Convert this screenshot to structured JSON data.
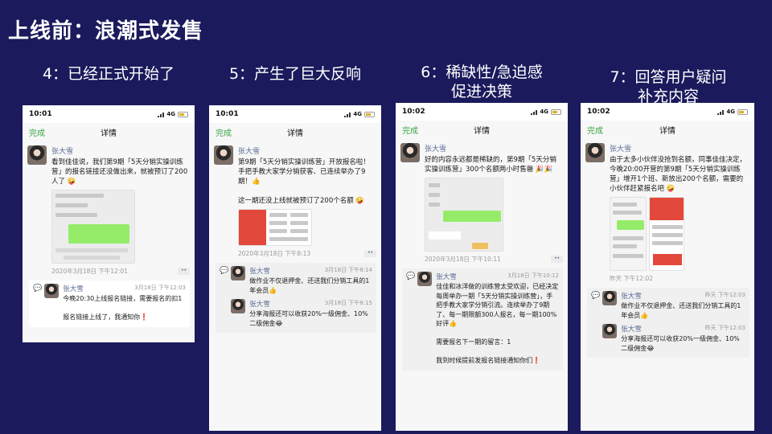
{
  "slide": {
    "title": "上线前：浪潮式发售"
  },
  "columns": [
    {
      "heading": "4：已经正式开始了",
      "status": {
        "time": "10:01",
        "network": "4G"
      },
      "nav": {
        "done": "完成",
        "title": "详情"
      },
      "post": {
        "name": "张大雪",
        "text": "看到佳佳说，我们第9期「5天分销实操训练营」的报名链接还没做出来，就被预订了200人了 🤪",
        "date": "2020年3月18日 下午12:01"
      },
      "comments": [
        {
          "name": "张大雪",
          "time": "3月18日 下午12:03",
          "text": "今晚20:30上线报名链接，需要报名的扣1\n\n报名链接上线了，我通知你❗"
        }
      ]
    },
    {
      "heading": "5：产生了巨大反响",
      "status": {
        "time": "10:01",
        "network": "4G"
      },
      "nav": {
        "done": "完成",
        "title": "详情"
      },
      "post": {
        "name": "张大雪",
        "text": "第9期「5天分销实操训练营」开放报名啦！手把手教大家学分销获客、已连续举办了9期！👍\n\n这一期还没上线就被预订了200个名额 🤪",
        "date": "2020年3月18日 下午8:13"
      },
      "comments": [
        {
          "name": "张大雪",
          "time": "3月18日 下午8:14",
          "text": "做作业不仅退押金、还送我们分销工具的1年会员👍"
        },
        {
          "name": "张大雪",
          "time": "3月18日 下午8:15",
          "text": "分享海报还可以收获20%一级佣金、10%二级佣金😂"
        }
      ]
    },
    {
      "heading": "6：稀缺性/急迫感\n促进决策",
      "status": {
        "time": "10:02",
        "network": "4G"
      },
      "nav": {
        "done": "完成",
        "title": "详情"
      },
      "post": {
        "name": "张大雪",
        "text": "好的内容永远都是稀缺的，第9期「5天分销实操训练营」300个名额两小时售罄 🎉🎉",
        "date": "2020年3月18日 下午10:11"
      },
      "comments": [
        {
          "name": "张大雪",
          "time": "3月18日 下午10:12",
          "text": "佳佳和冰洋做的训练营太受欢迎，已经决定每周举办一期「5天分销实操训练营」，手把手教大家学分销引流。连续举办了9期了、每一期限额300人报名，每一期100%好评👍\n\n需要报名下一期的留言：1\n\n我到时候提前发报名链接通知你们❗"
        }
      ]
    },
    {
      "heading": "7：回答用户疑问\n补充内容",
      "status": {
        "time": "10:02",
        "network": "4G"
      },
      "nav": {
        "done": "完成",
        "title": "详情"
      },
      "post": {
        "name": "张大雪",
        "text": "由于太多小伙伴没抢到名额，同事佳佳决定，今晚20:00开营的第9期「5天分销实操训练营」增开1个班、新放出200个名额，需要的小伙伴赶紧报名吧 🤪",
        "date": "昨天 下午12:02"
      },
      "comments": [
        {
          "name": "张大雪",
          "time": "昨天 下午12:03",
          "text": "做作业不仅退押金、还送我们分销工具的1年会员👍"
        },
        {
          "name": "张大雪",
          "time": "昨天 下午12:03",
          "text": "分享海报还可以收获20%一级佣金、10%二级佣金😂"
        }
      ]
    }
  ]
}
